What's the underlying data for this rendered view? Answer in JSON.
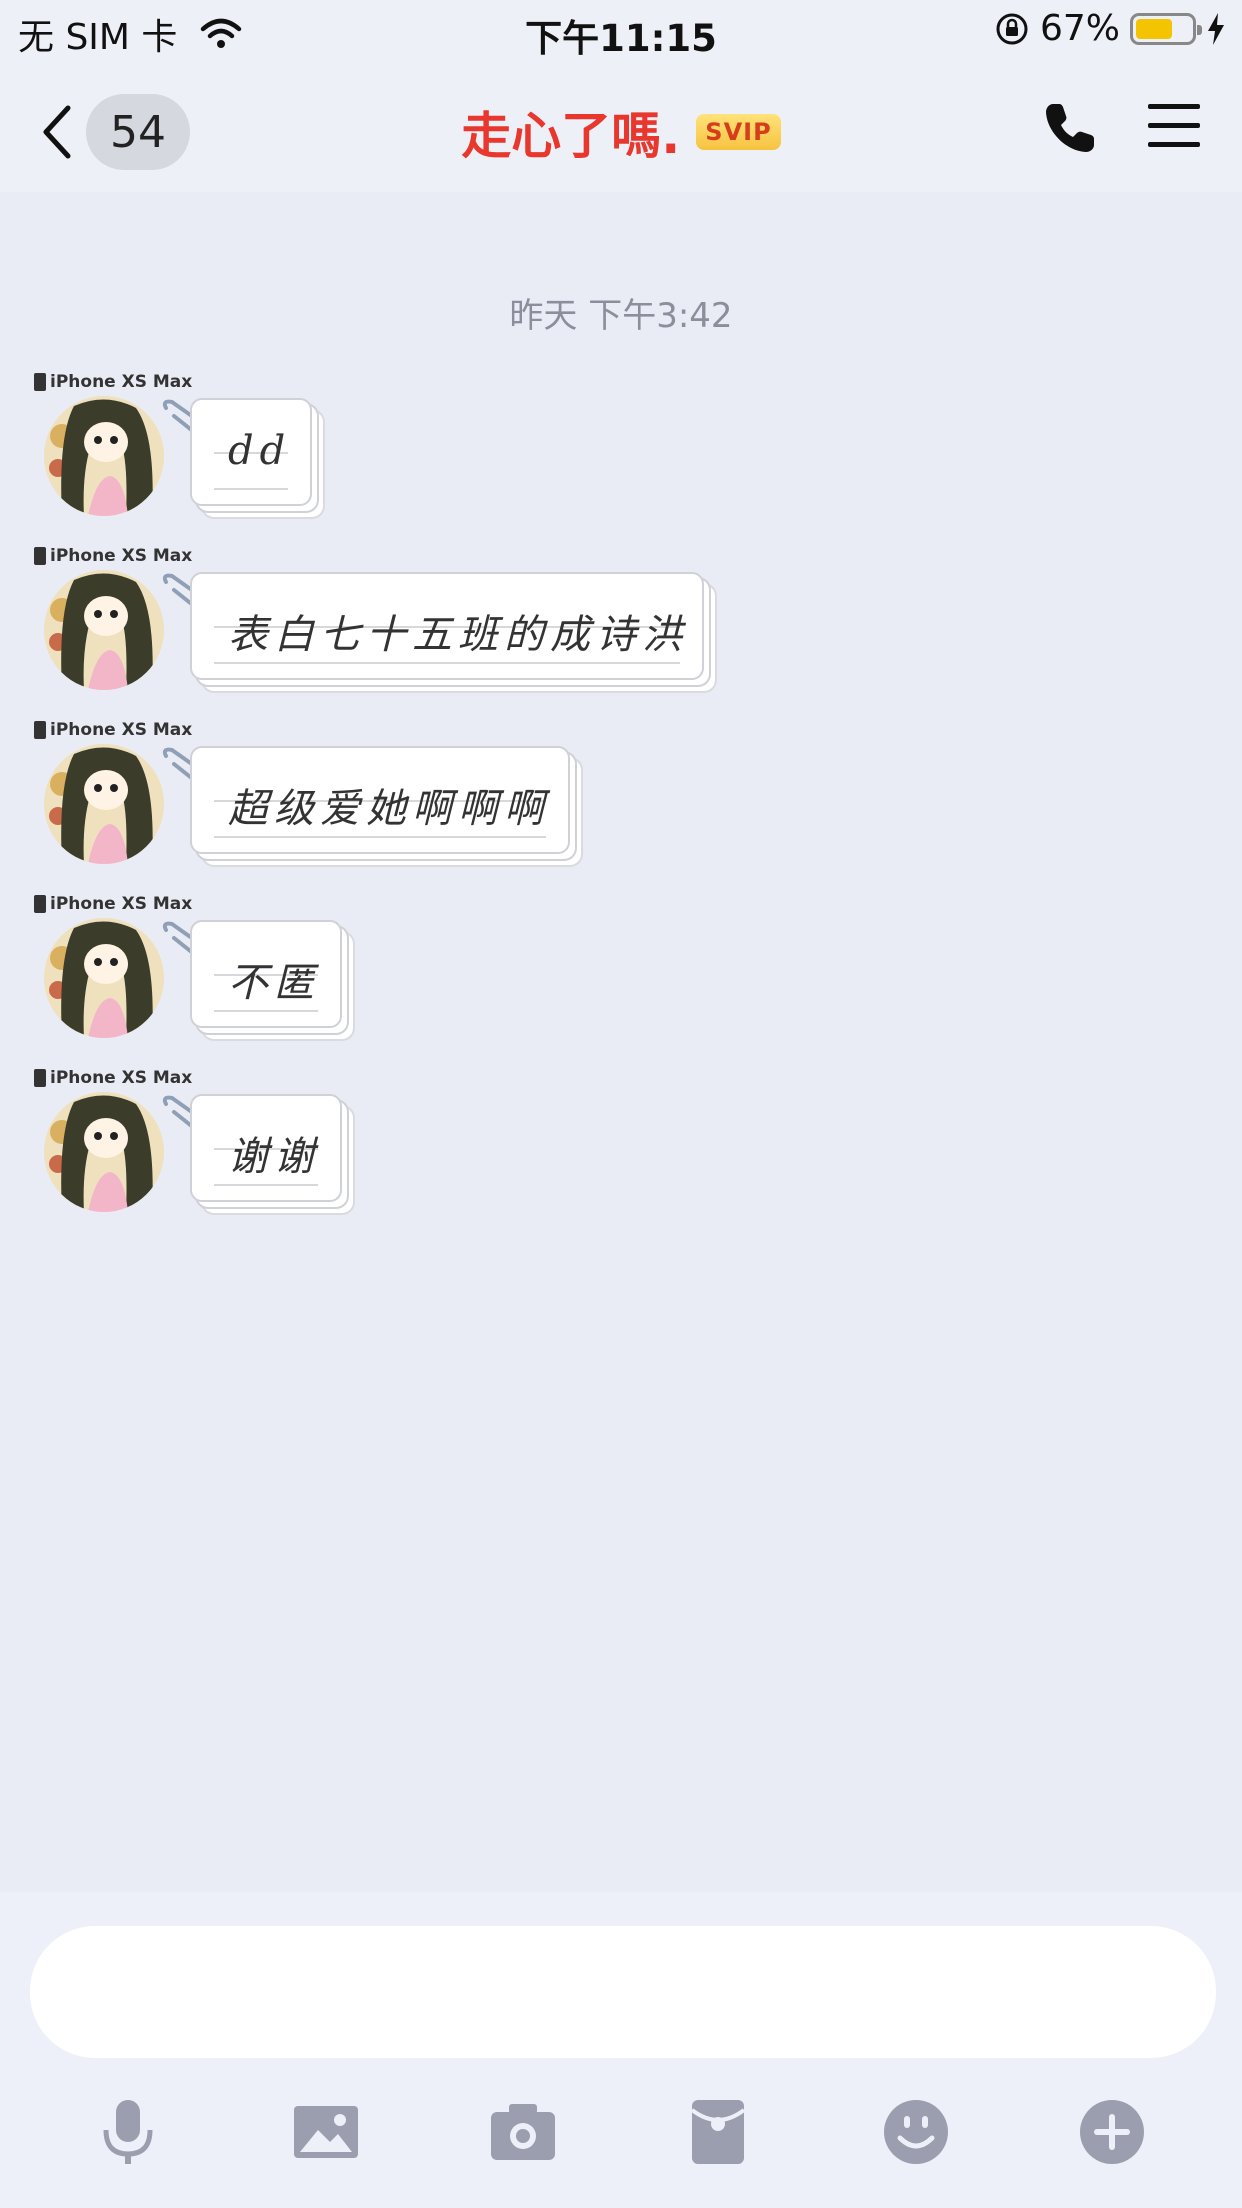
{
  "status_bar": {
    "carrier": "无 SIM 卡",
    "time": "下午11:15",
    "battery_percent": "67%",
    "battery_level": 0.67,
    "battery_color": "#f5c400"
  },
  "nav": {
    "back_count": "54",
    "title": "走心了嗎.",
    "badge": "SVIP",
    "title_color": "#e8382e",
    "icons": [
      "chevron-left-icon",
      "phone-icon",
      "menu-icon"
    ]
  },
  "chat": {
    "timestamp": "昨天 下午3:42",
    "messages": [
      {
        "device": "iPhone XS Max",
        "text": "dd"
      },
      {
        "device": "iPhone XS Max",
        "text": "表白七十五班的成诗洪"
      },
      {
        "device": "iPhone XS Max",
        "text": "超级爱她啊啊啊"
      },
      {
        "device": "iPhone XS Max",
        "text": "不匿"
      },
      {
        "device": "iPhone XS Max",
        "text": "谢谢"
      }
    ]
  },
  "input": {
    "placeholder": "",
    "toolbar_icons": [
      "microphone-icon",
      "image-icon",
      "camera-icon",
      "red-packet-icon",
      "emoji-icon",
      "plus-icon"
    ]
  }
}
